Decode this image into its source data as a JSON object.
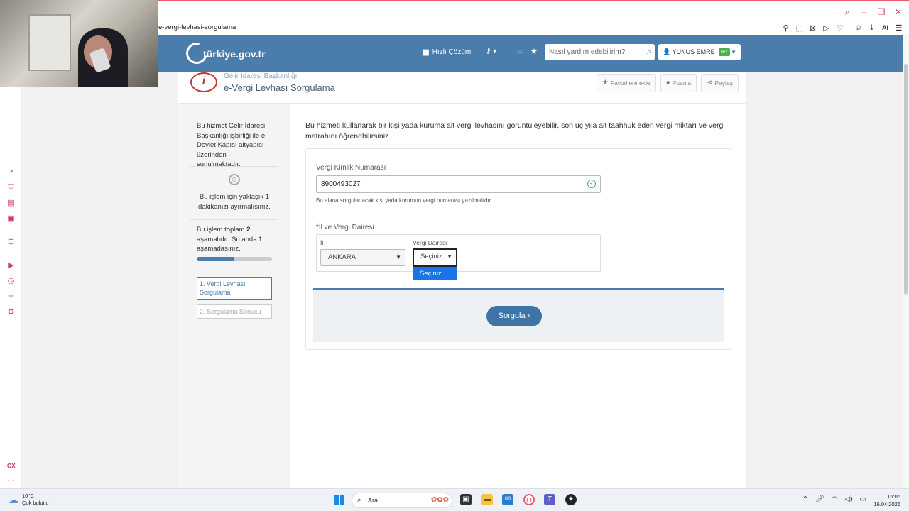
{
  "browser": {
    "url": "e-vergi-levhasi-sorgulama",
    "ai_label": "AI"
  },
  "header": {
    "logo_text": "türkiye.gov.tr",
    "quick_solution": "Hızlı Çözüm",
    "search_placeholder": "Nasıl yardım edebilirim?",
    "user_name": "YUNUS EMRE",
    "mail_badge": "7"
  },
  "service": {
    "org_name": "Gelir İdaresi Başkanlığı",
    "title": "e-Vergi Levhası Sorgulama",
    "favorite_label": "Favorilere ekle",
    "rate_label": "Puanla",
    "share_label": "Paylaş"
  },
  "sidebar": {
    "provider_text": "Bu hizmet Gelir İdaresi Başkanlığı işbirliği ile e-Devlet Kapısı altyapısı üzerinden sunulmaktadır.",
    "time_text": "Bu işlem için yaklaşık 1 dakikanızı ayırmalısınız.",
    "stage_text_prefix": "Bu işlem toplam ",
    "stage_total": "2",
    "stage_text_middle": " aşamalıdır. Şu anda ",
    "stage_current": "1",
    "stage_text_suffix": ". aşamadasınız.",
    "progress": 0.5,
    "steps": [
      {
        "label": "1. Vergi Levhası Sorgulama",
        "active": true
      },
      {
        "label": "2. Sorgulama Sonucu",
        "active": false
      }
    ]
  },
  "content": {
    "intro": "Bu hizmeti kullanarak bir kişi yada kuruma ait vergi levhasını görüntüleyebilir, son üç yıla ait taahhuk eden vergi miktarı ve vergi matrahını öğrenebilirsiniz.",
    "vkn_label": "Vergi Kimlik Numarası",
    "vkn_value": "8900493027",
    "vkn_hint": "Bu alana sorgulanacak kişi yada kurumun vergi numarası yazılmalıdır.",
    "region_label": "*İl ve Vergi Dairesi",
    "il_label": "İl",
    "il_value": "ANKARA",
    "vd_label": "Vergi Dairesi",
    "vd_value": "Seçiniz",
    "vd_dropdown_option": "Seçiniz",
    "submit_label": "Sorgula"
  },
  "taskbar": {
    "temp": "10°C",
    "weather": "Çok bulutlu",
    "search_label": "Ara",
    "time": "16:05",
    "date": "16.04.2026"
  },
  "colors": {
    "header_blue": "#4a7dab",
    "accent_red": "#e8566f",
    "dropdown_blue": "#1a73e8"
  }
}
